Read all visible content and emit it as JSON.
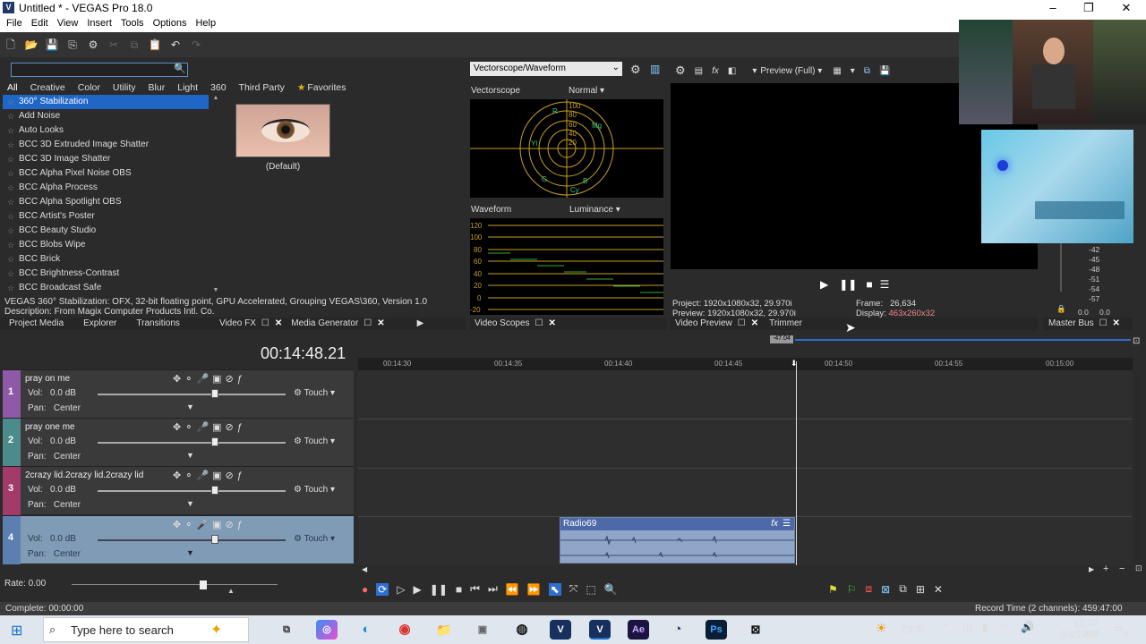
{
  "window": {
    "title": "Untitled * - VEGAS Pro 18.0",
    "logo": "V"
  },
  "menu": [
    "File",
    "Edit",
    "View",
    "Insert",
    "Tools",
    "Options",
    "Help"
  ],
  "fx": {
    "search_placeholder": "",
    "tabs": [
      "All",
      "Creative",
      "Color",
      "Utility",
      "Blur",
      "Light",
      "360",
      "Third Party",
      "Favorites"
    ],
    "items": [
      "360° Stabilization",
      "Add Noise",
      "Auto Looks",
      "BCC 3D Extruded Image Shatter",
      "BCC 3D Image Shatter",
      "BCC Alpha Pixel Noise OBS",
      "BCC Alpha Process",
      "BCC Alpha Spotlight OBS",
      "BCC Artist's Poster",
      "BCC Beauty Studio",
      "BCC Blobs Wipe",
      "BCC Brick",
      "BCC Brightness-Contrast",
      "BCC Broadcast Safe"
    ],
    "preset_label": "(Default)",
    "desc_line1": "VEGAS 360° Stabilization: OFX, 32-bit floating point, GPU Accelerated, Grouping VEGAS\\360, Version 1.0",
    "desc_line2": "Description: From Magix Computer Products Intl. Co."
  },
  "left_tabs": [
    "Project Media",
    "Explorer",
    "Transitions",
    "Video FX",
    "Media Generator"
  ],
  "scopes": {
    "selector": "Vectorscope/Waveform",
    "vectorscope_label": "Vectorscope",
    "vectorscope_mode": "Normal",
    "vs_ticks": [
      "100",
      "80",
      "60",
      "40",
      "20"
    ],
    "vs_targets": [
      "R",
      "Mg",
      "B",
      "Cy",
      "G",
      "Yl"
    ],
    "waveform_label": "Waveform",
    "waveform_mode": "Luminance",
    "wf_ticks": [
      "120",
      "100",
      "80",
      "60",
      "40",
      "20",
      "0",
      "-20"
    ],
    "tab": "Video Scopes"
  },
  "preview": {
    "quality": "Preview (Full)",
    "project_label": "Project:",
    "project_value": "1920x1080x32, 29.970i",
    "preview_label": "Preview:",
    "preview_value": "1920x1080x32, 29.970i",
    "frame_label": "Frame:",
    "frame_value": "26,634",
    "display_label": "Display:",
    "display_value": "463x260x32",
    "tabs": [
      "Video Preview",
      "Trimmer"
    ],
    "master_tab": "Master Bus",
    "meter_ticks": [
      "-42",
      "-45",
      "-48",
      "-51",
      "-54",
      "-57"
    ],
    "meter_vals": [
      "0.0",
      "0.0"
    ]
  },
  "timeline": {
    "timecode": "00:14:48.21",
    "ruler": [
      "00:14:30",
      "00:14:35",
      "00:14:40",
      "00:14:45",
      "00:14:50",
      "00:14:55",
      "00:15:00"
    ],
    "marker": "-47.04",
    "tracks": [
      {
        "num": "1",
        "name": "pray on me",
        "vol": "0.0 dB",
        "pan": "Center",
        "color": "#8e5aa8"
      },
      {
        "num": "2",
        "name": "pray one me",
        "vol": "0.0 dB",
        "pan": "Center",
        "color": "#4b8b8b"
      },
      {
        "num": "3",
        "name": "2crazy lid.2crazy lid.2crazy lid",
        "vol": "0.0 dB",
        "pan": "Center",
        "color": "#a23a6a"
      },
      {
        "num": "4",
        "name": "",
        "vol": "0.0 dB",
        "pan": "Center",
        "color": "#5a7fb0"
      }
    ],
    "vol_label": "Vol:",
    "pan_label": "Pan:",
    "touch": "Touch",
    "clip_name": "Radio69",
    "rate": "Rate: 0.00"
  },
  "status": {
    "left": "Complete: 00:00:00",
    "right": "Record Time (2 channels): 459:47:00"
  },
  "taskbar": {
    "search": "Type here to search",
    "weather": "73°F",
    "time": "12:07 AM",
    "date": "3/4/2026",
    "notif": "2"
  }
}
